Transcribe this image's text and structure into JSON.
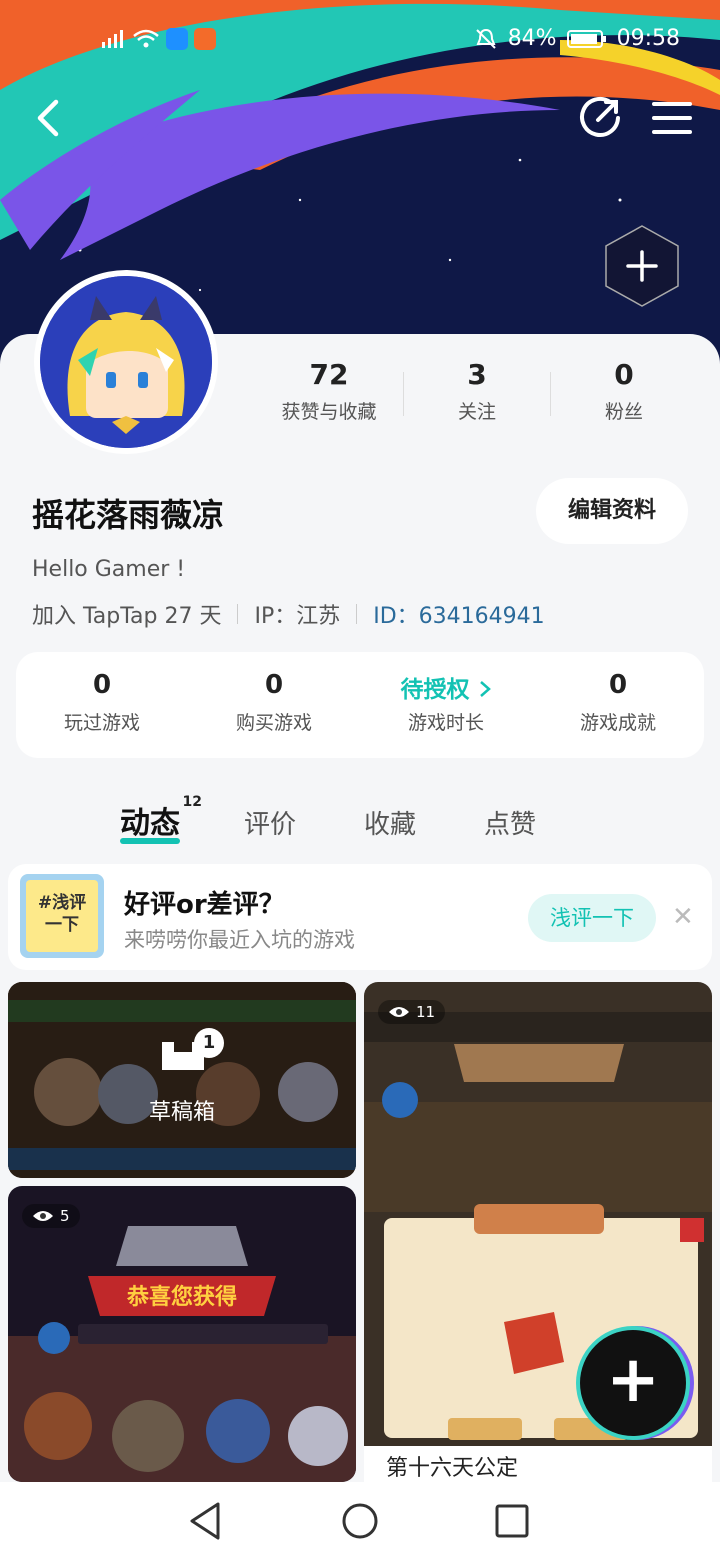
{
  "status_bar": {
    "battery": "84%",
    "time": "09:58"
  },
  "profile": {
    "name": "摇花落雨薇凉",
    "bio": "Hello Gamer !",
    "joined": "加入 TapTap 27 天",
    "ip": "IP：江苏",
    "id": "ID：634164941",
    "edit_button": "编辑资料",
    "stats": [
      {
        "value": "72",
        "label": "获赞与收藏"
      },
      {
        "value": "3",
        "label": "关注"
      },
      {
        "value": "0",
        "label": "粉丝"
      }
    ]
  },
  "game_stats": [
    {
      "value": "0",
      "label": "玩过游戏"
    },
    {
      "value": "0",
      "label": "购买游戏"
    },
    {
      "value": "待授权",
      "label": "游戏时长"
    },
    {
      "value": "0",
      "label": "游戏成就"
    }
  ],
  "tabs": [
    {
      "label": "动态",
      "count": "12"
    },
    {
      "label": "评价"
    },
    {
      "label": "收藏"
    },
    {
      "label": "点赞"
    }
  ],
  "promo": {
    "icon_text_1": "#浅评",
    "icon_text_2": "一下",
    "title": "好评or差评？",
    "subtitle": "来唠唠你最近入坑的游戏",
    "button": "浅评一下"
  },
  "posts": {
    "draft": {
      "label": "草稿箱",
      "badge": "1"
    },
    "post_left": {
      "views": "5"
    },
    "post_right": {
      "views": "11",
      "title": "第十六天公定"
    }
  },
  "icons": {
    "back": "chevron-left-icon",
    "share": "share-icon",
    "menu": "menu-icon",
    "add": "plus-icon",
    "eye": "eye-icon"
  },
  "colors": {
    "accent": "#13c2b3",
    "id_link": "#2a6a9a"
  }
}
